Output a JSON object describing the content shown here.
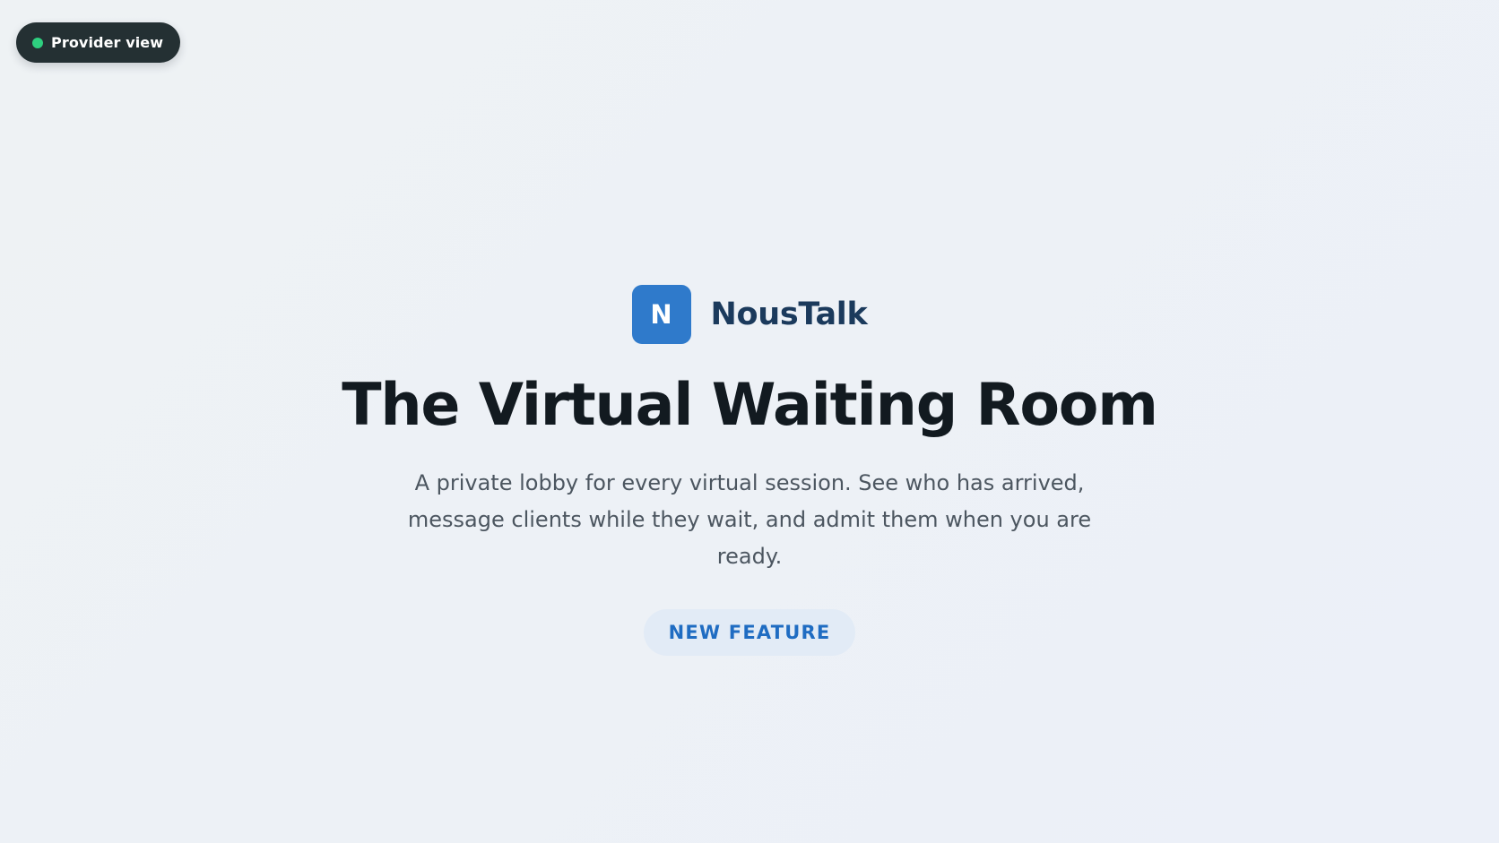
{
  "provider_toggle": {
    "label": "Provider view",
    "status_color": "#2ecf7f"
  },
  "brand": {
    "logo_letter": "N",
    "name": "NousTalk",
    "accent_color": "#2f7acb"
  },
  "hero": {
    "title": "The Virtual Waiting Room",
    "subtitle": "A private lobby for every virtual session. See who has arrived, message clients while they wait, and admit them when you are ready.",
    "badge": "NEW FEATURE"
  }
}
